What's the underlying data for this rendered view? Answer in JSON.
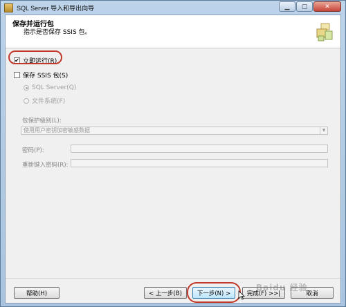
{
  "window": {
    "title": "SQL Server 导入和导出向导",
    "controls": {
      "minimize": "▁",
      "maximize": "▢",
      "close": "✕"
    }
  },
  "header": {
    "title": "保存并运行包",
    "subtitle": "指示是否保存 SSIS 包。"
  },
  "options": {
    "run_immediately": {
      "label": "立即运行(R)",
      "checked": true
    },
    "save_ssis": {
      "label": "保存 SSIS 包(S)",
      "checked": false
    },
    "radio_sql_server": {
      "label": "SQL Server(Q)",
      "selected": true,
      "enabled": false
    },
    "radio_file_system": {
      "label": "文件系统(F)",
      "selected": false,
      "enabled": false
    }
  },
  "protection": {
    "label": "包保护级别(L):",
    "value": "使用用户密钥加密敏感数据"
  },
  "password": {
    "label": "密码(P):",
    "value": ""
  },
  "reenter_password": {
    "label": "重新键入密码(R):",
    "value": ""
  },
  "buttons": {
    "help": "帮助(H)",
    "back": "< 上一步(B)",
    "next": "下一步(N) >",
    "finish": "完成(F) >>|",
    "cancel": "取消"
  },
  "watermark": "Baidu 经验",
  "colors": {
    "highlight_oval": "#c0392b",
    "accent": "#3c7fb1"
  }
}
